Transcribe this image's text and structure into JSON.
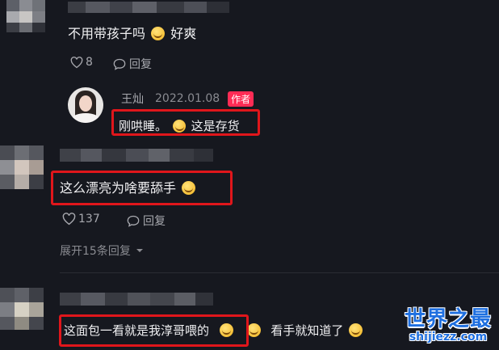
{
  "comments": [
    {
      "text_a": "不用带孩子吗",
      "text_b": "好爽",
      "likes": "8",
      "reply_label": "回复"
    },
    {
      "author": "王灿",
      "date": "2022.01.08",
      "author_tag": "作者",
      "text_a": "刚哄睡。",
      "text_b": "这是存货"
    },
    {
      "text_a": "这么漂亮为啥要舔手",
      "likes": "137",
      "reply_label": "回复",
      "expand_label": "展开15条回复"
    },
    {
      "text_a": "这面包一看就是我淳哥喂的",
      "text_b": "看手就知道了"
    }
  ],
  "watermark": {
    "title": "世界之最",
    "url": "shijiezz.com"
  },
  "colors": {
    "background": "#16181f",
    "highlight_box": "#e0161b",
    "author_tag": "#fe2c55",
    "watermark": "#1e6fe0"
  },
  "icons": [
    "heart-icon",
    "comment-icon",
    "emoji-icon",
    "chevron-down-icon"
  ]
}
